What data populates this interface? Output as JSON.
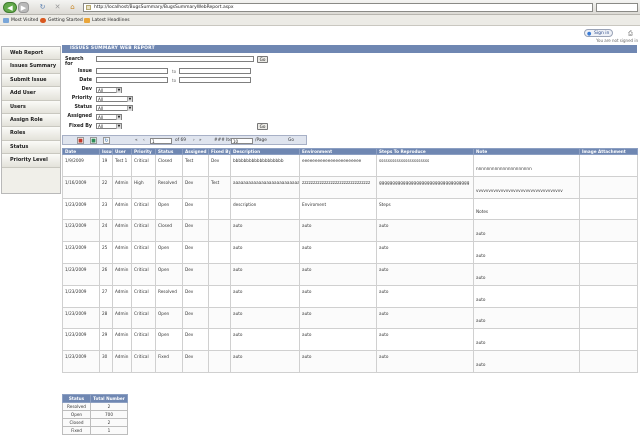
{
  "browser": {
    "url": "http://localhost/BugsSummary/BugsSummaryWebReport.aspx",
    "bookmarks": [
      "Most Visited",
      "Getting Started",
      "Latest Headlines"
    ],
    "signin_label": "Sign in",
    "signin_status": "You are not signed in"
  },
  "sidebar": {
    "items": [
      "Web Report",
      "Issues Summary",
      "Submit Issue",
      "Add User",
      "Users",
      "Assign Role",
      "Roles",
      "Status",
      "Priority Level"
    ]
  },
  "report": {
    "title": "ISSUES SUMMARY WEB REPORT",
    "filters": {
      "search_for": "Search for",
      "issue": "Issue",
      "date": "Date",
      "dev": "Dev",
      "priority": "Priority",
      "status": "Status",
      "assigned": "Assigned",
      "fixed_by": "Fixed By",
      "to": "to",
      "all": "All",
      "go": "Go"
    },
    "pager": {
      "page_value": "1",
      "of_label": "of 69",
      "items_label": "### Items",
      "page_size": "10",
      "page_label": "/Page",
      "go": "Go"
    },
    "columns": [
      "Date",
      "Issue",
      "User",
      "Priority",
      "Status",
      "Assigned",
      "Fixed By",
      "Description",
      "Environment",
      "Steps To Reproduce",
      "Note",
      "Image Attachment"
    ],
    "rows": [
      [
        "1/9/2009",
        "19",
        "Test 1",
        "Critical",
        "Closed",
        "Test",
        "Dev",
        "bbbbbbbbbbbbbbbbbbb",
        "eeeeeeeeeeeeeeeeeeeeeee",
        "sssssssssssssssssssssss",
        "nnnnnnnnnnnnnnnnnnnnn",
        ""
      ],
      [
        "1/16/2009",
        "22",
        "Admin",
        "High",
        "Resolved",
        "Dev",
        "Test",
        "aaaaaaaaaaaaaaaaaaaaaaaaaa",
        "zzzzzzzzzzzzzzzzzzzzzzzzzzzzzzz",
        "gggggggggggggggggggggggggggggggggg",
        "vvvvvvvvvvvvvvvvvvvvvvvvvvvvvvvvvvv",
        ""
      ],
      [
        "1/23/2009",
        "23",
        "Admin",
        "Critical",
        "Open",
        "Dev",
        "",
        "description",
        "Enviroment",
        "Steps",
        "Notes",
        ""
      ],
      [
        "1/23/2009",
        "24",
        "Admin",
        "Critical",
        "Closed",
        "Dev",
        "",
        "auto",
        "auto",
        "auto",
        "auto",
        ""
      ],
      [
        "1/23/2009",
        "25",
        "Admin",
        "Critical",
        "Open",
        "Dev",
        "",
        "auto",
        "auto",
        "auto",
        "auto",
        ""
      ],
      [
        "1/23/2009",
        "26",
        "Admin",
        "Critical",
        "Open",
        "Dev",
        "",
        "auto",
        "auto",
        "auto",
        "auto",
        ""
      ],
      [
        "1/23/2009",
        "27",
        "Admin",
        "Critical",
        "Resolved",
        "Dev",
        "",
        "auto",
        "auto",
        "auto",
        "auto",
        ""
      ],
      [
        "1/23/2009",
        "28",
        "Admin",
        "Critical",
        "Open",
        "Dev",
        "",
        "auto",
        "auto",
        "auto",
        "auto",
        ""
      ],
      [
        "1/23/2009",
        "29",
        "Admin",
        "Critical",
        "Open",
        "Dev",
        "",
        "auto",
        "auto",
        "auto",
        "auto",
        ""
      ],
      [
        "1/23/2009",
        "30",
        "Admin",
        "Critical",
        "Fixed",
        "Dev",
        "",
        "auto",
        "auto",
        "auto",
        "auto",
        ""
      ]
    ],
    "summary": {
      "headers": [
        "Status",
        "Total Number"
      ],
      "rows": [
        [
          "Resolved",
          "2"
        ],
        [
          "Open",
          "700"
        ],
        [
          "Closed",
          "2"
        ],
        [
          "Fixed",
          "1"
        ]
      ]
    }
  }
}
